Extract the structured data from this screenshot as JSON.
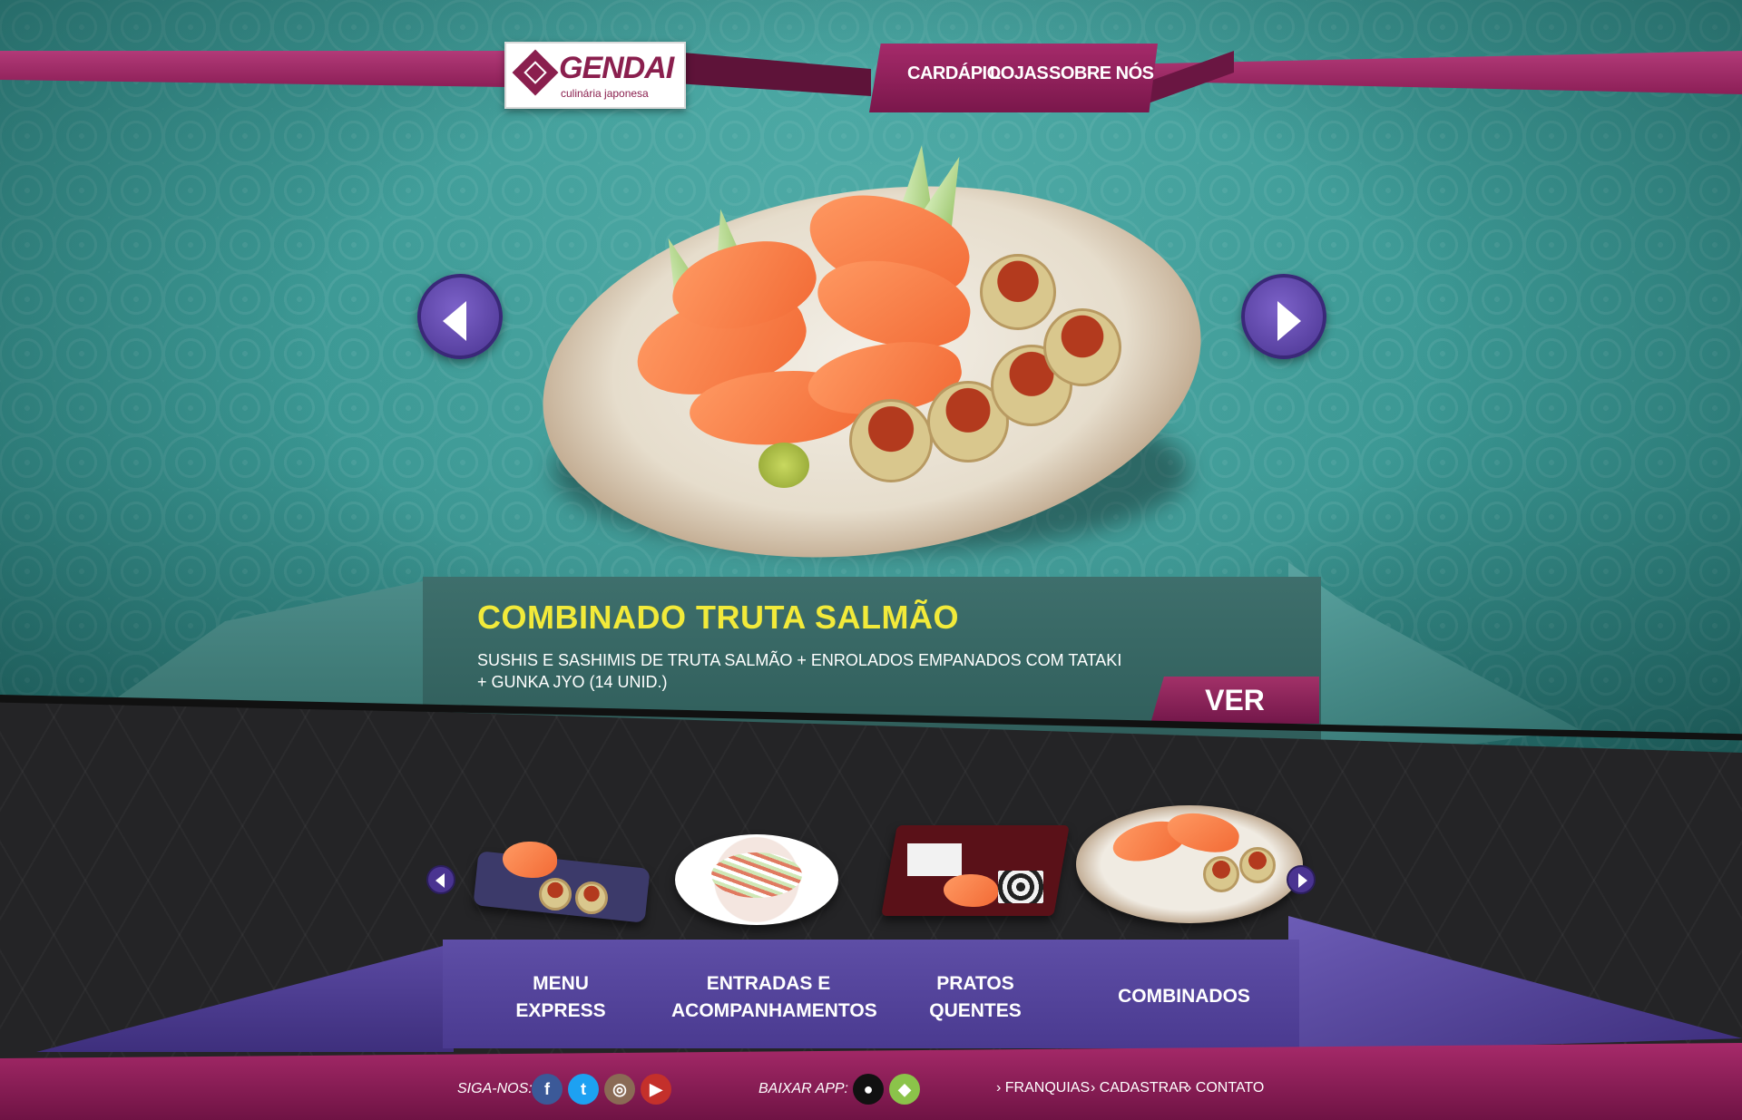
{
  "brand": {
    "name": "GENDAI",
    "tagline": "culinária japonesa"
  },
  "nav": {
    "items": [
      {
        "label": "CARDÁPIO"
      },
      {
        "label": "LOJAS"
      },
      {
        "label": "SOBRE NÓS"
      }
    ]
  },
  "hero": {
    "title": "COMBINADO TRUTA SALMÃO",
    "description": "SUSHIS E SASHIMIS DE TRUTA SALMÃO + ENROLADOS EMPANADOS COM TATAKI + GUNKA JYO (14 UNID.)",
    "price_button": "VER PREÇO",
    "prev_icon": "chevron-left-icon",
    "next_icon": "chevron-right-icon"
  },
  "categories": [
    {
      "label": "MENU EXPRESS"
    },
    {
      "label": "ENTRADAS E ACOMPANHAMENTOS"
    },
    {
      "label": "PRATOS QUENTES"
    },
    {
      "label": "COMBINADOS"
    }
  ],
  "footer": {
    "follow_label": "SIGA-NOS:",
    "download_label": "BAIXAR APP:",
    "social": [
      {
        "icon": "facebook-icon",
        "glyph": "f",
        "color": "#3b5998"
      },
      {
        "icon": "twitter-icon",
        "glyph": "t",
        "color": "#1da1f2"
      },
      {
        "icon": "instagram-icon",
        "glyph": "◎",
        "color": "#8a6a55"
      },
      {
        "icon": "youtube-icon",
        "glyph": "▶",
        "color": "#c4302b"
      }
    ],
    "apps": [
      {
        "icon": "apple-icon",
        "color": "#111111"
      },
      {
        "icon": "android-icon",
        "color": "#8bc34a"
      }
    ],
    "links": [
      {
        "label": "› FRANQUIAS"
      },
      {
        "label": "› CADASTRAR"
      },
      {
        "label": "› CONTATO"
      }
    ]
  },
  "colors": {
    "teal": "#3f9c98",
    "magenta": "#8c1f57",
    "purple": "#4a3491",
    "title_yellow": "#f2ea3a"
  }
}
